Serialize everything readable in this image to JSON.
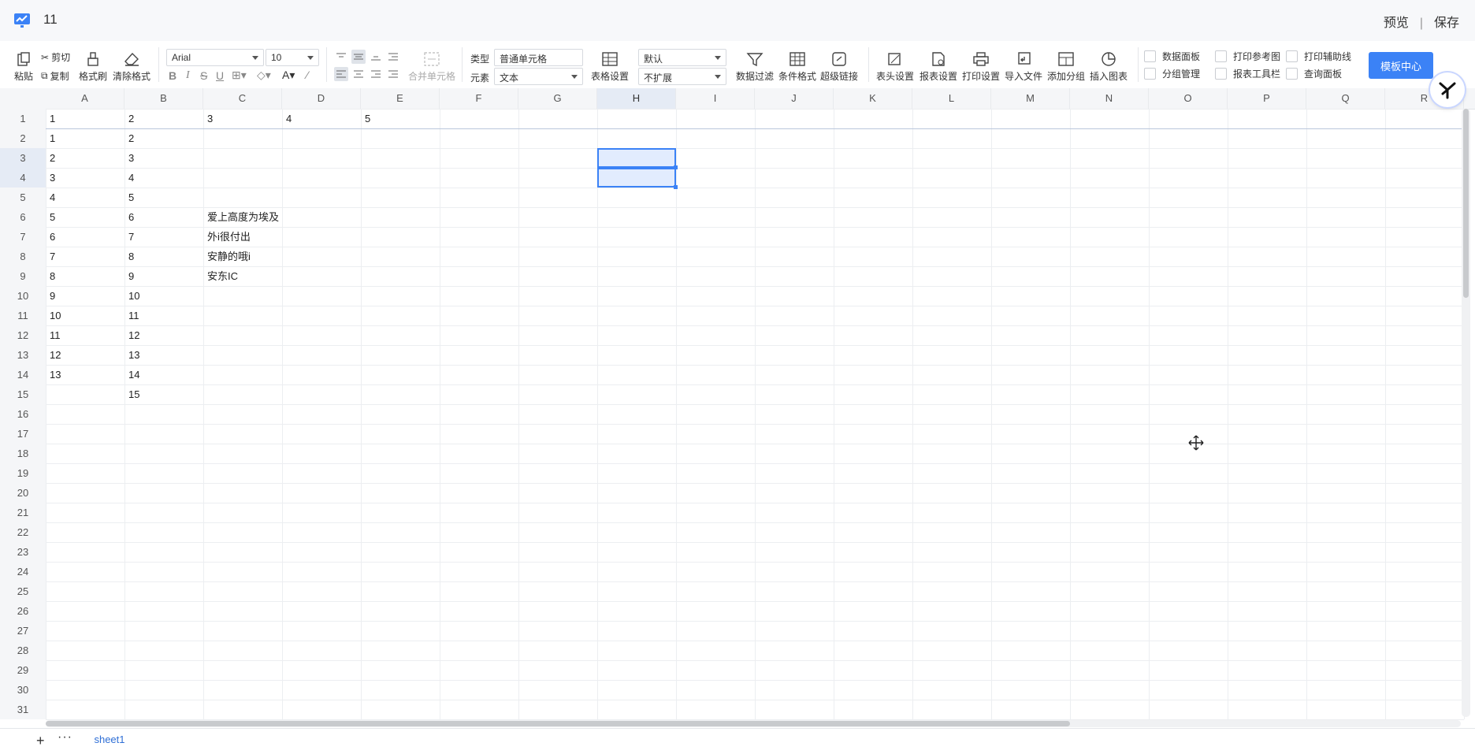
{
  "titlebar": {
    "title": "11",
    "preview": "预览",
    "separator": "|",
    "save": "保存"
  },
  "toolbar": {
    "paste": "粘贴",
    "cut": "剪切",
    "copy": "复制",
    "format_painter": "格式刷",
    "clear_format": "清除格式",
    "font_family": "Arial",
    "font_size": "10",
    "merge_cells": "合并单元格",
    "type_label": "类型",
    "type_value": "普通单元格",
    "element_label": "元素",
    "element_value": "文本",
    "table_settings": "表格设置",
    "default_select": "默认",
    "expand_select": "不扩展",
    "data_filter": "数据过滤",
    "conditional_format": "条件格式",
    "hyperlink": "超级链接",
    "header_settings": "表头设置",
    "report_settings": "报表设置",
    "print_settings": "打印设置",
    "import_file": "导入文件",
    "add_group": "添加分组",
    "insert_chart": "插入图表",
    "checks": {
      "data_panel": "数据面板",
      "group_manage": "分组管理",
      "print_ref": "打印参考图",
      "report_toolbar": "报表工具栏",
      "print_guides": "打印辅助线",
      "query_panel": "查询面板"
    },
    "template_center": "模板中心"
  },
  "columns": [
    "A",
    "B",
    "C",
    "D",
    "E",
    "F",
    "G",
    "H",
    "I",
    "J",
    "K",
    "L",
    "M",
    "N",
    "O",
    "P",
    "Q",
    "R"
  ],
  "rows": [
    "1",
    "2",
    "3",
    "4",
    "5",
    "6",
    "7",
    "8",
    "9",
    "10",
    "11",
    "12",
    "13",
    "14",
    "15",
    "16",
    "17",
    "18",
    "19",
    "20",
    "21",
    "22",
    "23",
    "24",
    "25",
    "26",
    "27",
    "28",
    "29",
    "30",
    "31"
  ],
  "cells": {
    "r1": [
      "1",
      "2",
      "3",
      "4",
      "5"
    ],
    "A": [
      "1",
      "2",
      "3",
      "4",
      "5",
      "6",
      "7",
      "8",
      "9",
      "10",
      "11",
      "12",
      "13",
      ""
    ],
    "B": [
      "2",
      "3",
      "4",
      "5",
      "6",
      "7",
      "8",
      "9",
      "10",
      "11",
      "12",
      "13",
      "14",
      "15"
    ],
    "C6": "爱上高度为埃及",
    "C7": "外i很付出",
    "C8": "安静的哦i",
    "C9": "安东IC"
  },
  "sheet": {
    "add": "+",
    "more": "···",
    "tab": "sheet1"
  },
  "colors": {
    "accent": "#3b82f6",
    "sheet_tab": "#2f6fd6"
  }
}
